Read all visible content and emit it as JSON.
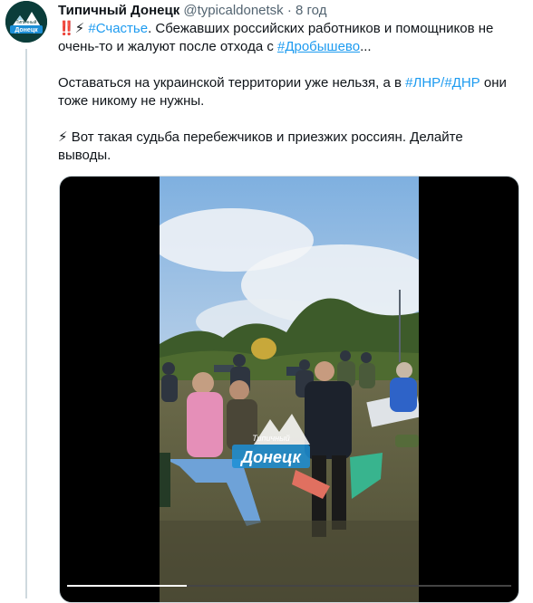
{
  "tweet": {
    "author_name": "Типичный Донецк",
    "author_handle": "@typicaldonetsk",
    "separator": "·",
    "time": "8 год",
    "avatar_logo_line1": "Типичный",
    "avatar_logo_line2": "Донецк",
    "text": {
      "p1_emoji": "‼️⚡ ",
      "p1_tag": "#Счастье",
      "p1_rest": ". Сбежавших российских работников и помощников не очень-то и жалуют после отхода с ",
      "p1_link": "#Дробышево",
      "p1_ellipsis": "...",
      "p2_start": "Оставаться на украинской территории уже нельзя, а в ",
      "p2_tag1": "#ЛНР",
      "p2_slash": "/",
      "p2_tag2": "#ДНР",
      "p2_end": " они тоже никому не нужны.",
      "p3_emoji": "⚡ ",
      "p3_text": "Вот такая судьба перебежчиков и приезжих россиян. Делайте выводы."
    },
    "media": {
      "watermark_line1": "Типичный",
      "watermark_line2": "Донецк",
      "progress": 0.27
    }
  },
  "colors": {
    "link": "#1d9bf0",
    "secondary_text": "#536471",
    "thread_line": "#cfd9de"
  }
}
